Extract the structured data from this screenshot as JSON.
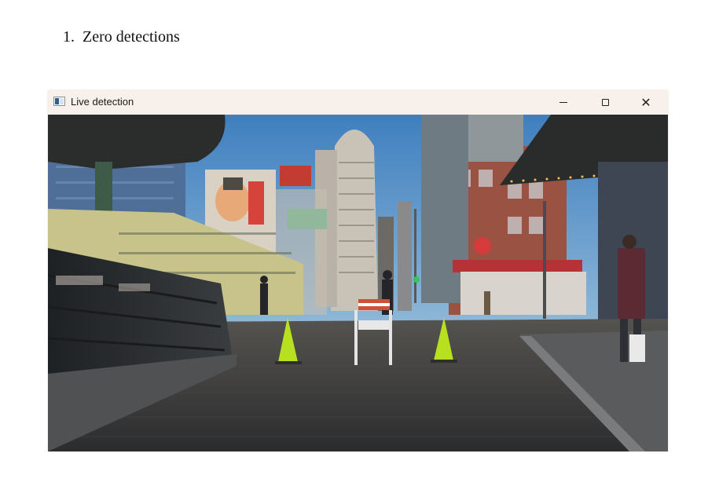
{
  "document": {
    "item_number": "1.",
    "heading": "Zero detections"
  },
  "window": {
    "title": "Live detection",
    "icons": {
      "app": "app-window-icon",
      "minimize": "minimize-icon",
      "maximize": "maximize-icon",
      "close": "close-icon"
    },
    "close_glyph": "✕"
  },
  "scene": {
    "description_colors": {
      "sky": "#4d8fc8",
      "street": "#3c3d3f",
      "cone": "#b7e021"
    }
  }
}
